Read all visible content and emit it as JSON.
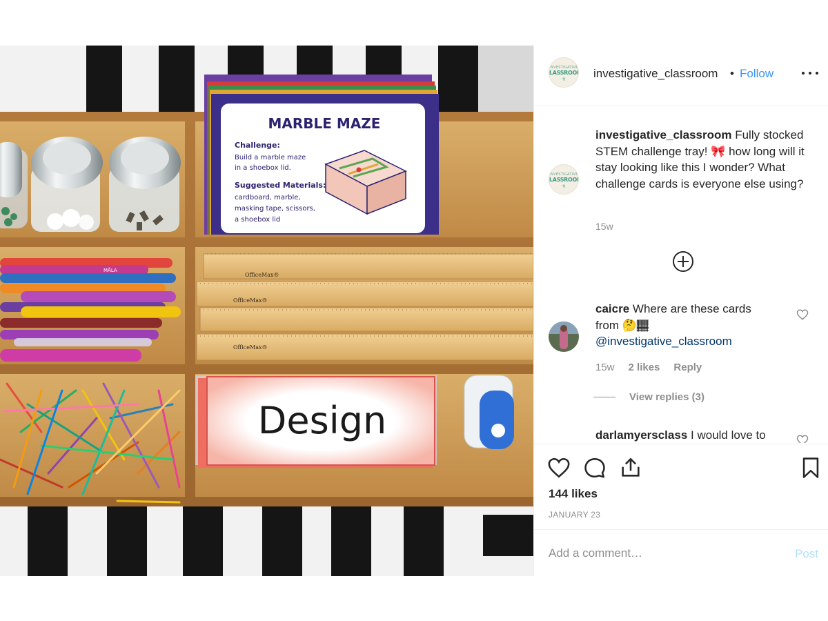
{
  "photo": {
    "alt_content": "STEM challenge tray",
    "maze_card": {
      "title": "MARBLE MAZE",
      "challenge_heading": "Challenge:",
      "challenge_lines": [
        "Build a marble maze",
        "in a shoebox lid."
      ],
      "materials_heading": "Suggested Materials:",
      "materials_lines": [
        "cardboard, marble,",
        "masking tape, scissors,",
        "a shoebox lid"
      ]
    },
    "design_card": "Design",
    "ruler_brand": "OfficeMax®",
    "pen_brand": "MÅLA",
    "user_tag_icon": "user-silhouette-icon"
  },
  "header": {
    "avatar_logo_top": "INVESTIGATIVE",
    "avatar_logo_word": "CLASSROOM",
    "username": "investigative_classroom",
    "separator": "•",
    "follow_label": "Follow",
    "more_icon": "more-horizontal-icon"
  },
  "caption": {
    "username": "investigative_classroom",
    "text_part1": "Fully stocked STEM challenge tray!",
    "emoji": "🎀",
    "text_part2": "how long will it stay looking like this I wonder? What challenge cards is everyone else using?",
    "time": "15w",
    "load_more_icon": "plus-circle-icon"
  },
  "comments": [
    {
      "username": "caicre",
      "text": "Where are these cards from",
      "emoji": "🤔🏾",
      "mention": "@investigative_classroom",
      "time": "15w",
      "likes": "2 likes",
      "reply": "Reply",
      "view_replies": "View replies (3)"
    },
    {
      "username": "darlamyersclass",
      "text": "I would love to"
    }
  ],
  "actions": {
    "like_icon": "heart-icon",
    "comment_icon": "comment-icon",
    "share_icon": "share-icon",
    "save_icon": "bookmark-icon",
    "likes_count": "144 likes",
    "date": "JANUARY 23"
  },
  "comment_box": {
    "placeholder": "Add a comment…",
    "post_label": "Post"
  },
  "colors": {
    "link": "#3897f0",
    "mention": "#003569",
    "muted": "#8e8e8e",
    "post_disabled": "#b2dffc",
    "text": "#262626"
  }
}
